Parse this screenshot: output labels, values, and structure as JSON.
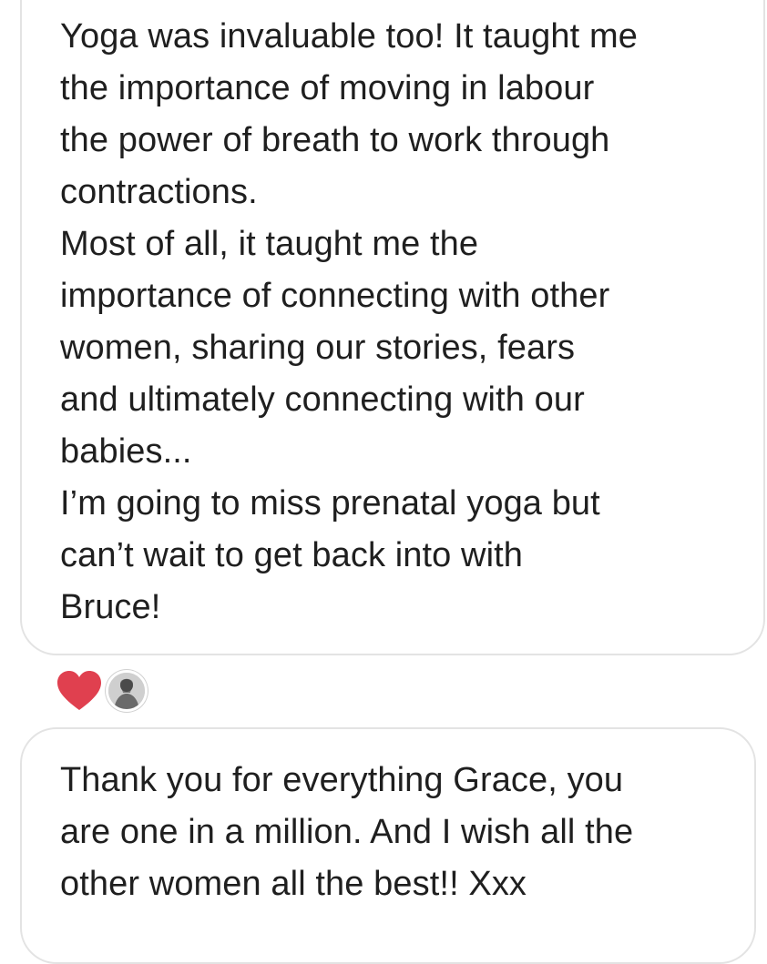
{
  "messages": [
    {
      "lines": [
        "Yoga was invaluable too! It taught me",
        "the importance of moving in labour",
        "the power of breath to work through",
        "contractions.",
        "Most of all, it taught me the",
        "importance of connecting with other",
        "women, sharing our stories, fears",
        "and ultimately connecting with our",
        "babies...",
        "I’m going to miss prenatal yoga but",
        "can’t wait to get back into with",
        "Bruce!"
      ]
    },
    {
      "lines": [
        "Thank you for everything Grace, you",
        "are one in a million. And I wish all the",
        "other women all the best!! Xxx"
      ]
    }
  ],
  "reactions": {
    "heart_icon": "heart-icon",
    "heart_color": "#e0404f",
    "avatar_icon": "avatar"
  },
  "colors": {
    "bubble_border": "#e3e3e3",
    "text": "#1f1f1f",
    "background": "#ffffff"
  }
}
